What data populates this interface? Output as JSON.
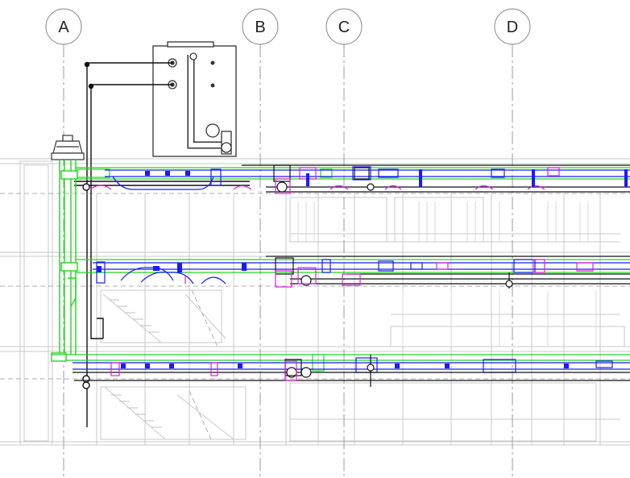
{
  "drawing": {
    "colors": {
      "background": "#ffffff",
      "ghost_structure": "#c8c8c8",
      "grid_line": "#9a9a9a",
      "pipe_black": "#111111",
      "duct_green": "#1fd61f",
      "duct_blue": "#1a1aff",
      "fitting_magenta": "#e020e0",
      "equipment_outline": "#333333"
    },
    "grid_lines": [
      {
        "id": "A",
        "label": "A"
      },
      {
        "id": "B",
        "label": "B"
      },
      {
        "id": "C",
        "label": "C"
      },
      {
        "id": "D",
        "label": "D"
      }
    ],
    "levels": [
      {
        "id": "upper"
      },
      {
        "id": "middle"
      },
      {
        "id": "lower"
      }
    ],
    "equipment": [
      {
        "id": "rooftop-unit",
        "icon": "air-handler-unit"
      },
      {
        "id": "roof-exhaust-fan",
        "icon": "exhaust-fan-hood"
      }
    ]
  }
}
